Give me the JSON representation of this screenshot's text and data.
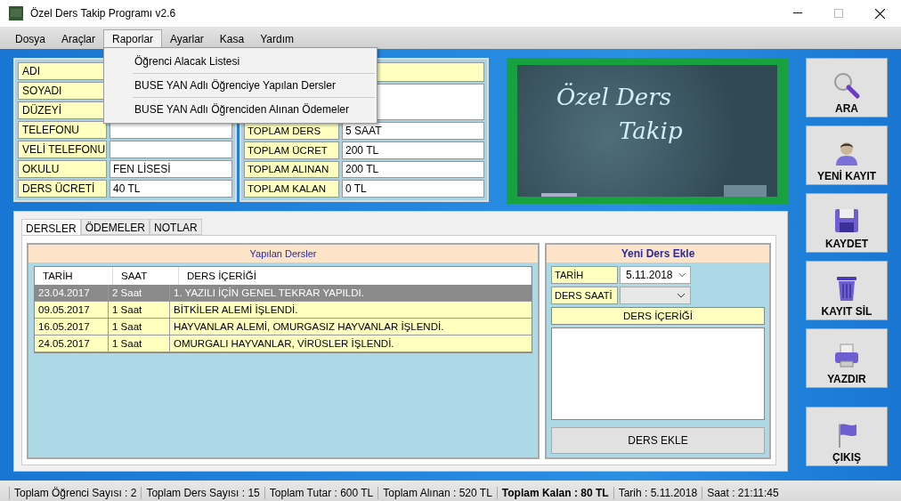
{
  "window": {
    "title": "Özel Ders Takip Programı v2.6"
  },
  "menu": [
    {
      "label": "Dosya",
      "selected": false
    },
    {
      "label": "Araçlar",
      "selected": false
    },
    {
      "label": "Raporlar",
      "selected": true
    },
    {
      "label": "Ayarlar",
      "selected": false
    },
    {
      "label": "Kasa",
      "selected": false
    },
    {
      "label": "Yardım",
      "selected": false
    }
  ],
  "open_menu": {
    "items": [
      "Öğrenci Alacak Listesi",
      "BUSE YAN Adlı Öğrenciye Yapılan Dersler",
      "BUSE YAN Adlı Öğrenciden Alınan Ödemeler"
    ]
  },
  "student_form": {
    "fields": [
      {
        "label": "ADI"
      },
      {
        "label": "SOYADI"
      },
      {
        "label": "DÜZEYİ"
      },
      {
        "label": "TELEFONU",
        "blank": true
      },
      {
        "label": "VELİ TELEFONU",
        "blank": true
      },
      {
        "label": "OKULU",
        "value": "FEN LİSESİ"
      },
      {
        "label": "DERS ÜCRETİ",
        "value": "40 TL"
      }
    ]
  },
  "summary": {
    "fields": [
      {
        "label": "TOPLAM DERS",
        "value": "5 SAAT"
      },
      {
        "label": "TOPLAM ÜCRET",
        "value": "200 TL"
      },
      {
        "label": "TOPLAM ALINAN",
        "value": "200 TL"
      },
      {
        "label": "TOPLAM KALAN",
        "value": "0 TL"
      }
    ]
  },
  "board": {
    "lines": [
      "Özel Ders",
      "Takip"
    ]
  },
  "tabs": [
    {
      "label": "DERSLER",
      "selected": true
    },
    {
      "label": "ÖDEMELER",
      "selected": false
    },
    {
      "label": "NOTLAR",
      "selected": false
    }
  ],
  "lessons": {
    "title": "Yapılan Dersler",
    "columns": [
      "TARİH",
      "SAAT",
      "DERS İÇERİĞİ"
    ],
    "rows": [
      {
        "cells": [
          "23.04.2017",
          "2 Saat",
          "1. YAZILI İÇİN GENEL TEKRAR YAPILDI."
        ],
        "selected": true
      },
      {
        "cells": [
          "09.05.2017",
          "1 Saat",
          "BİTKİLER ALEMİ İŞLENDİ."
        ],
        "selected": false
      },
      {
        "cells": [
          "16.05.2017",
          "1 Saat",
          "HAYVANLAR ALEMİ, OMURGASIZ HAYVANLAR İŞLENDİ."
        ],
        "selected": false
      },
      {
        "cells": [
          "24.05.2017",
          "1 Saat",
          "OMURGALI HAYVANLAR, VİRÜSLER İŞLENDİ."
        ],
        "selected": false
      }
    ]
  },
  "new_lesson": {
    "title": "Yeni Ders Ekle",
    "date_label": "TARİH",
    "date_value": "5.11.2018",
    "hour_label": "DERS SAATİ",
    "hour_disabled": true,
    "content_label": "DERS İÇERİĞİ",
    "button": "DERS EKLE"
  },
  "side_buttons": [
    {
      "label": "ARA",
      "kind": "search"
    },
    {
      "label": "YENİ KAYIT",
      "kind": "person"
    },
    {
      "label": "KAYDET",
      "kind": "save"
    },
    {
      "label": "KAYIT SİL",
      "kind": "trash"
    },
    {
      "label": "YAZDIR",
      "kind": "printer"
    },
    {
      "label": "ÇIKIŞ",
      "kind": "flag"
    }
  ],
  "status_bar": [
    {
      "text": "Toplam Öğrenci Sayısı : 2",
      "bold": false
    },
    {
      "text": "Toplam Ders Sayısı : 15",
      "bold": false
    },
    {
      "text": "Toplam Tutar : 600 TL",
      "bold": false
    },
    {
      "text": "Toplam Alınan : 520 TL",
      "bold": false
    },
    {
      "text": "Toplam Kalan : 80 TL",
      "bold": true
    },
    {
      "text": "Tarih : 5.11.2018",
      "bold": false
    },
    {
      "text": "Saat : 21:11:45",
      "bold": false
    }
  ]
}
